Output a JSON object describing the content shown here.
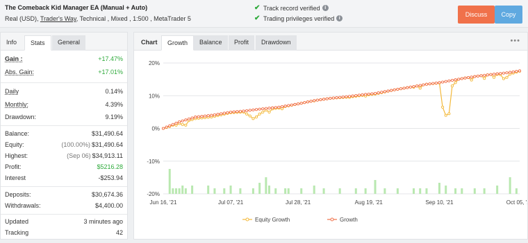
{
  "header": {
    "title": "The Comeback Kid Manager EA (Manual + Auto)",
    "sub_prefix": "Real (USD),",
    "broker": "Trader's Way",
    "sub_suffix": ", Technical , Mixed , 1:500 , MetaTrader 5",
    "verify1": "Track record verified",
    "verify2": "Trading privileges verified",
    "discuss": "Discuss",
    "copy": "Copy"
  },
  "left_tabs": [
    "Info",
    "Stats",
    "General"
  ],
  "stats": {
    "gain": {
      "label": "Gain :",
      "value": "+17.47%"
    },
    "abs_gain": {
      "label": "Abs. Gain:",
      "value": "+17.01%"
    },
    "daily": {
      "label": "Daily",
      "value": "0.14%"
    },
    "monthly": {
      "label": "Monthly:",
      "value": "4.39%"
    },
    "drawdown": {
      "label": "Drawdown:",
      "value": "9.19%"
    },
    "balance": {
      "label": "Balance:",
      "value": "$31,490.64"
    },
    "equity": {
      "label": "Equity:",
      "prefix": "(100.00%)",
      "value": "$31,490.64"
    },
    "highest": {
      "label": "Highest:",
      "prefix": "(Sep 06)",
      "value": "$34,913.11"
    },
    "profit": {
      "label": "Profit:",
      "value": "$5216.28"
    },
    "interest": {
      "label": "Interest",
      "value": "-$253.94"
    },
    "deposits": {
      "label": "Deposits:",
      "value": "$30,674.36"
    },
    "withdrawals": {
      "label": "Withdrawals:",
      "value": "$4,400.00"
    },
    "updated": {
      "label": "Updated",
      "value": "3 minutes ago"
    },
    "tracking": {
      "label": "Tracking",
      "value": "42"
    }
  },
  "chart_tabs": {
    "label": "Chart",
    "tabs": [
      "Growth",
      "Balance",
      "Profit",
      "Drawdown"
    ]
  },
  "chart_data": {
    "type": "line",
    "ylim": [
      -20,
      20
    ],
    "ytick_labels": [
      "20%",
      "10%",
      "0%",
      "-10%",
      "-20%"
    ],
    "ytick_values": [
      20,
      10,
      0,
      -10,
      -20
    ],
    "xtick_labels": [
      "Jun 16, '21",
      "Jul 07, '21",
      "Jul 28, '21",
      "Aug 19, '21",
      "Sep 10, '21",
      "Oct 05, '21"
    ],
    "xtick_index": [
      0,
      21,
      42,
      64,
      86,
      111
    ],
    "n_points": 112,
    "colors": {
      "equity": "#f3b93b",
      "growth": "#f0714a",
      "volume": "#b9e8b0"
    },
    "series": [
      {
        "name": "Equity Growth",
        "points": [
          [
            0,
            0
          ],
          [
            5,
            1.5
          ],
          [
            10,
            3
          ],
          [
            15,
            3.5
          ],
          [
            21,
            4.8
          ],
          [
            25,
            5
          ],
          [
            28,
            3.2
          ],
          [
            32,
            5.6
          ],
          [
            36,
            6.3
          ],
          [
            42,
            7.5
          ],
          [
            47,
            8.5
          ],
          [
            52,
            9.2
          ],
          [
            58,
            9.6
          ],
          [
            62,
            10.1
          ],
          [
            66,
            10.5
          ],
          [
            72,
            11.8
          ],
          [
            78,
            12.8
          ],
          [
            82,
            13.5
          ],
          [
            86,
            13.9
          ],
          [
            90,
            14.7
          ],
          [
            94,
            15.4
          ],
          [
            98,
            16
          ],
          [
            103,
            16.6
          ],
          [
            107,
            16.3
          ],
          [
            111,
            17.5
          ]
        ],
        "dips": [
          [
            3,
            1
          ],
          [
            4,
            1
          ],
          [
            6,
            1.2
          ],
          [
            7,
            1
          ],
          [
            28,
            3
          ],
          [
            29,
            3.5
          ],
          [
            33,
            5
          ],
          [
            36,
            6.2
          ],
          [
            37,
            6
          ],
          [
            47,
            8.4
          ],
          [
            58,
            9.5
          ],
          [
            63,
            9.9
          ],
          [
            78,
            12.6
          ],
          [
            80,
            12.3
          ],
          [
            87,
            6.5
          ],
          [
            88,
            4
          ],
          [
            89,
            4.5
          ],
          [
            90,
            13
          ],
          [
            91,
            14
          ],
          [
            96,
            14.8
          ],
          [
            100,
            15.3
          ],
          [
            103,
            15.6
          ],
          [
            106,
            15.2
          ],
          [
            107,
            15.6
          ]
        ]
      },
      {
        "name": "Growth",
        "points": [
          [
            0,
            0
          ],
          [
            5,
            2
          ],
          [
            10,
            3.5
          ],
          [
            15,
            4
          ],
          [
            21,
            5
          ],
          [
            25,
            5.3
          ],
          [
            30,
            5.9
          ],
          [
            36,
            6.5
          ],
          [
            42,
            7.5
          ],
          [
            47,
            8.5
          ],
          [
            52,
            9.2
          ],
          [
            58,
            9.8
          ],
          [
            62,
            10.3
          ],
          [
            66,
            10.7
          ],
          [
            72,
            11.8
          ],
          [
            78,
            12.8
          ],
          [
            82,
            13.5
          ],
          [
            86,
            14
          ],
          [
            90,
            14.7
          ],
          [
            94,
            15.4
          ],
          [
            98,
            16
          ],
          [
            103,
            16.6
          ],
          [
            107,
            17
          ],
          [
            111,
            17.6
          ]
        ]
      }
    ],
    "volume": [
      [
        2,
        9
      ],
      [
        3,
        2
      ],
      [
        4,
        2
      ],
      [
        5,
        2
      ],
      [
        6,
        3
      ],
      [
        7,
        2
      ],
      [
        9,
        3
      ],
      [
        14,
        3
      ],
      [
        16,
        2
      ],
      [
        19,
        2
      ],
      [
        21,
        3
      ],
      [
        24,
        2
      ],
      [
        28,
        2
      ],
      [
        30,
        4
      ],
      [
        32,
        6
      ],
      [
        33,
        3
      ],
      [
        35,
        2
      ],
      [
        38,
        2
      ],
      [
        39,
        2
      ],
      [
        43,
        2
      ],
      [
        47,
        3
      ],
      [
        50,
        2
      ],
      [
        55,
        2
      ],
      [
        60,
        2
      ],
      [
        63,
        2
      ],
      [
        66,
        5
      ],
      [
        69,
        2
      ],
      [
        73,
        2
      ],
      [
        78,
        2
      ],
      [
        80,
        2
      ],
      [
        82,
        2
      ],
      [
        86,
        4
      ],
      [
        88,
        3
      ],
      [
        91,
        2
      ],
      [
        93,
        2
      ],
      [
        97,
        2
      ],
      [
        100,
        2
      ],
      [
        104,
        3
      ],
      [
        108,
        6
      ],
      [
        110,
        2
      ]
    ]
  }
}
